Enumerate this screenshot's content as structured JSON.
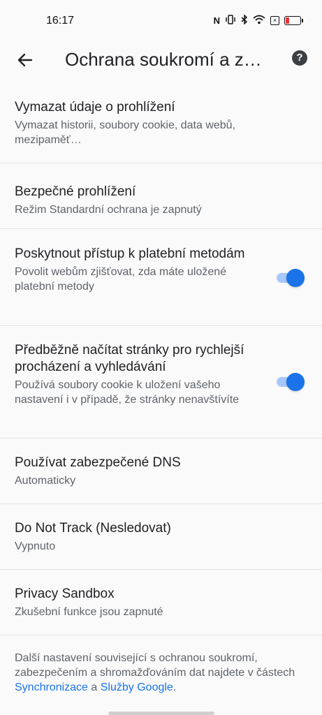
{
  "status_bar": {
    "time": "16:17",
    "icons": [
      "nfc-icon",
      "vibrate-icon",
      "bluetooth-icon",
      "wifi-icon",
      "x-box-icon",
      "battery-low-icon"
    ]
  },
  "app_bar": {
    "title": "Ochrana soukromí a z…"
  },
  "items": [
    {
      "title": "Vymazat údaje o prohlížení",
      "subtitle": "Vymazat historii, soubory cookie, data webů, mezipaměť…"
    },
    {
      "title": "Bezpečné prohlížení",
      "subtitle": "Režim Standardní ochrana je zapnutý"
    },
    {
      "title": "Poskytnout přístup k platební metodám",
      "subtitle": "Povolit webům zjišťovat, zda máte uložené platební metody",
      "toggle_on": true
    },
    {
      "title": "Předběžně načítat stránky pro rychlejší procházení a vyhledávání",
      "subtitle": "Používá soubory cookie k uložení vašeho nastavení i v případě, že stránky nenavštívíte",
      "toggle_on": true
    },
    {
      "title": "Používat zabezpečené DNS",
      "subtitle": "Automaticky"
    },
    {
      "title": "Do Not Track (Nesledovat)",
      "subtitle": "Vypnuto"
    },
    {
      "title": "Privacy Sandbox",
      "subtitle": "Zkušební funkce jsou zapnuté"
    }
  ],
  "footer": {
    "text_before": "Další nastavení související s ochranou soukromí, zabezpečením a shromažďováním dat najdete v částech ",
    "link_sync": "Synchronizace",
    "middle": " a ",
    "link_google": "Služby Google",
    "end": "."
  },
  "colors": {
    "accent": "#1a73e8",
    "toggle_track": "#a8c7fa",
    "background": "#fafafa"
  }
}
